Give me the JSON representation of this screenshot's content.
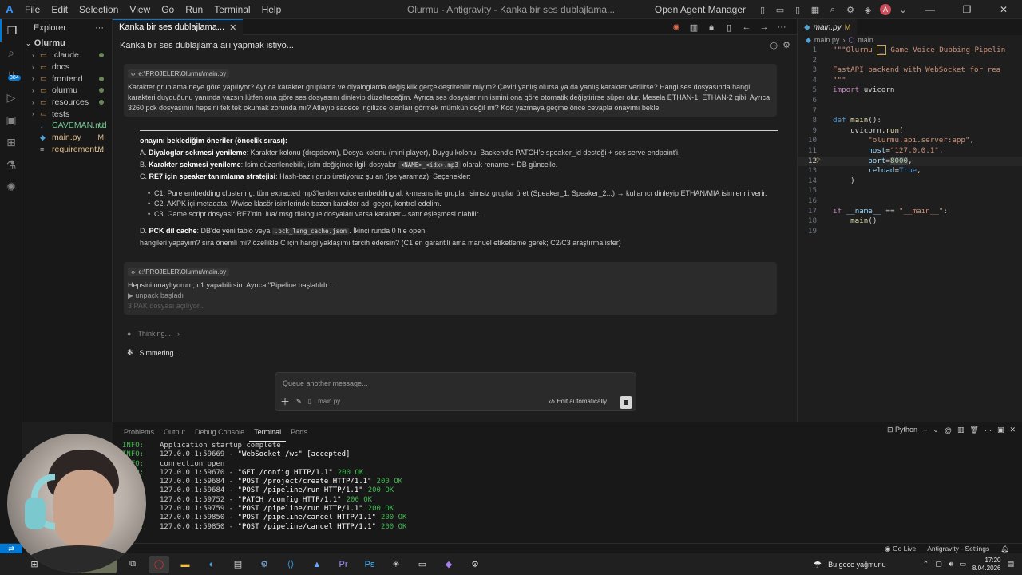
{
  "titlebar": {
    "menu": [
      "File",
      "Edit",
      "Selection",
      "View",
      "Go",
      "Run",
      "Terminal",
      "Help"
    ],
    "window_title": "Olurmu - Antigravity - Kanka bir ses dublajlama...",
    "open_agent_manager": "Open Agent Manager",
    "avatar_letter": "A"
  },
  "explorer": {
    "title": "Explorer",
    "root": "Olurmu",
    "items": [
      {
        "name": ".claude",
        "type": "folder",
        "status": "dot"
      },
      {
        "name": "docs",
        "type": "folder",
        "status": ""
      },
      {
        "name": "frontend",
        "type": "folder",
        "status": "dot"
      },
      {
        "name": "olurmu",
        "type": "folder",
        "status": "dot"
      },
      {
        "name": "resources",
        "type": "folder",
        "status": "dot"
      },
      {
        "name": "tests",
        "type": "folder",
        "status": ""
      },
      {
        "name": "CAVEMAN.md",
        "type": "file",
        "status": "U"
      },
      {
        "name": "main.py",
        "type": "file",
        "status": "M"
      },
      {
        "name": "requirement...",
        "type": "file",
        "status": "M"
      }
    ]
  },
  "chat": {
    "tab_title": "Kanka bir ses dublajlama...",
    "header": "Kanka bir ses dublajlama ai'i yapmak istiyo...",
    "user_msg1": {
      "file": "e:\\PROJELER\\Olurmu\\main.py",
      "text": "Karakter gruplama neye göre yapılıyor? Ayrıca karakter gruplama ve diyaloglarda değişiklik gerçekleştirebilir miyim? Çeviri yanlış olursa ya da yanlış karakter verilirse? Hangi ses dosyasında hangi karakteri duyduğunu yanında yazsın lütfen ona göre ses dosyasını dinleyip düzelteceğim. Ayrıca ses dosyalarının ismini ona göre otomatik değiştirirse süper olur. Mesela ETHAN-1, ETHAN-2 gibi. Ayrıca 3260 pck dosyasının hepsini tek tek okumak zorunda mı? Atlayıp sadece ingilizce olanları görmek mümkün değil mi? Kod yazmaya geçme önce cevapla onayımı bekle"
    },
    "response": {
      "heading": "onayını beklediğim öneriler (öncelik sırası):",
      "a_label": "A.",
      "a_title": "Diyaloglar sekmesi yenileme",
      "a_text": ": Karakter kolonu (dropdown), Dosya kolonu (mini player), Duygu kolonu. Backend'e PATCH'e speaker_id desteği + ses serve endpoint'i.",
      "b_label": "B.",
      "b_title": "Karakter sekmesi yenileme",
      "b_text1": ": İsim düzenlenebilir, isim değişince ilgili dosyalar ",
      "b_code": "<NAME>_<idx>.mp3",
      "b_text2": " olarak rename + DB güncelle.",
      "c_label": "C.",
      "c_title": "RE7 için speaker tanımlama stratejisi",
      "c_text": ": Hash-bazlı grup üretiyoruz şu an (işe yaramaz). Seçenekler:",
      "c_options": [
        "C1. Pure embedding clustering: tüm extracted mp3'lerden voice embedding al, k-means ile grupla, isimsiz gruplar üret (Speaker_1, Speaker_2...) → kullanıcı dinleyip ETHAN/MIA isimlerini verir.",
        "C2. AKPK içi metadata: Wwise klasör isimlerinde bazen karakter adı geçer, kontrol edelim.",
        "C3. Game script dosyası: RE7'nin .lua/.msg dialogue dosyaları varsa karakter→satır eşleşmesi olabilir."
      ],
      "d_label": "D.",
      "d_title": "PCK dil cache",
      "d_text1": ": DB'de yeni tablo veya ",
      "d_code": ".pck_lang_cache.json",
      "d_text2": ". İkinci runda 0 file open.",
      "question": "hangileri yapayım? sıra önemli mi? özellikle C için hangi yaklaşımı tercih edersin? (C1 en garantili ama manuel etiketleme gerek; C2/C3 araştırma ister)"
    },
    "user_msg2": {
      "file": "e:\\PROJELER\\Olurmu\\main.py",
      "text": "Hepsini onaylıyorum, c1 yapabilirsin. Ayrıca \"Pipeline başlatıldı...",
      "line2": "▶ unpack başladı",
      "line3": "3 PAK dosyası açılıyor..."
    },
    "thinking": "Thinking...",
    "simmering": "Simmering...",
    "composer": {
      "placeholder": "Queue another message...",
      "file": "main.py",
      "mode": "Edit automatically"
    }
  },
  "editor": {
    "tab": "main.py",
    "tab_status": "M",
    "breadcrumb_file": "main.py",
    "breadcrumb_symbol": "main"
  },
  "panel": {
    "tabs": [
      "Problems",
      "Output",
      "Debug Console",
      "Terminal",
      "Ports"
    ],
    "active_tab": "Terminal",
    "language": "Python",
    "lines": [
      {
        "level": "INFO:",
        "msg": "Application startup complete.",
        "req": "",
        "status": ""
      },
      {
        "level": "INFO:",
        "msg": "127.0.0.1:59669 - ",
        "req": "\"WebSocket /ws\" [accepted]",
        "status": ""
      },
      {
        "level": "INFO:",
        "msg": "connection open",
        "req": "",
        "status": ""
      },
      {
        "level": "INFO:",
        "msg": "127.0.0.1:59670 - ",
        "req": "\"GET /config HTTP/1.1\"",
        "status": "200 OK"
      },
      {
        "level": "INFO:",
        "msg": "127.0.0.1:59684 - ",
        "req": "\"POST /project/create HTTP/1.1\"",
        "status": "200 OK"
      },
      {
        "level": "INFO:",
        "msg": "127.0.0.1:59684 - ",
        "req": "\"POST /pipeline/run HTTP/1.1\"",
        "status": "200 OK"
      },
      {
        "level": "INFO:",
        "msg": "127.0.0.1:59752 - ",
        "req": "\"PATCH /config HTTP/1.1\"",
        "status": "200 OK"
      },
      {
        "level": "INFO:",
        "msg": "127.0.0.1:59759 - ",
        "req": "\"POST /pipeline/run HTTP/1.1\"",
        "status": "200 OK"
      },
      {
        "level": "INFO:",
        "msg": "127.0.0.1:59850 - ",
        "req": "\"POST /pipeline/cancel HTTP/1.1\"",
        "status": "200 OK"
      },
      {
        "level": "INFO:",
        "msg": "127.0.0.1:59850 - ",
        "req": "\"POST /pipeline/cancel HTTP/1.1\"",
        "status": "200 OK"
      }
    ]
  },
  "statusbar": {
    "go_live": "Go Live",
    "settings": "Antigravity - Settings"
  },
  "taskbar": {
    "weather": "Bu gece yağmurlu",
    "time": "17:20",
    "date": "8.04.2026"
  }
}
